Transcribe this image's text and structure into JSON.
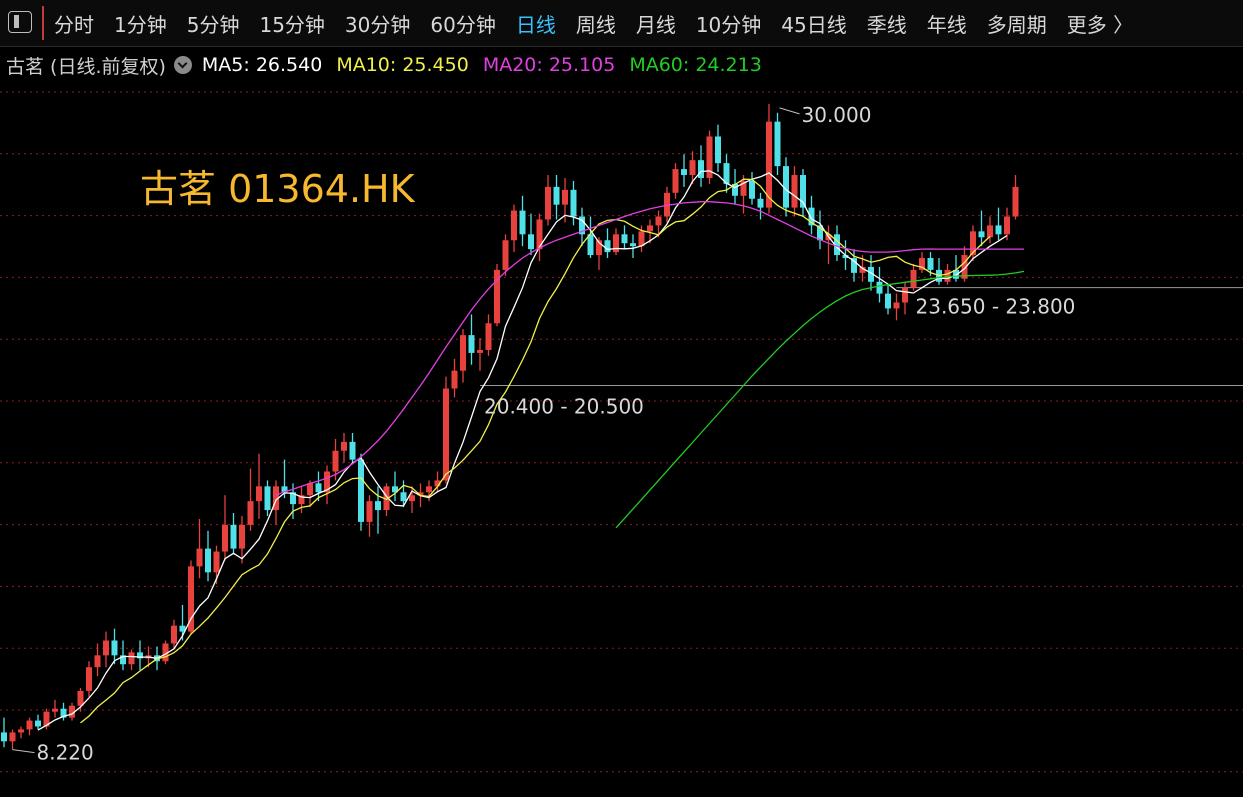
{
  "toolbar": {
    "tabs": [
      "分时",
      "1分钟",
      "5分钟",
      "15分钟",
      "30分钟",
      "60分钟",
      "日线",
      "周线",
      "月线",
      "10分钟",
      "45日线",
      "季线",
      "年线",
      "多周期",
      "更多 〉"
    ],
    "active_tab": "日线"
  },
  "legend": {
    "stock_label": "古茗 (日线.前复权)",
    "ma5": "MA5: 26.540",
    "ma10": "MA10: 25.450",
    "ma20": "MA20: 25.105",
    "ma60": "MA60: 24.213"
  },
  "colors": {
    "up": "#e8423f",
    "down": "#4fe0e8",
    "ma5": "#ffffff",
    "ma10": "#f0f04a",
    "ma20": "#e040e0",
    "ma60": "#22cc22",
    "title": "#f5b82e",
    "active_tab": "#39c0ff",
    "grid": "#8a1f1f"
  },
  "chart_data": {
    "type": "candlestick",
    "title": "古茗 01364.HK",
    "y_range": [
      7.6,
      30.4
    ],
    "annotations": {
      "high": {
        "label": "30.000",
        "value": 30.0
      },
      "low": {
        "label": "8.220",
        "value": 8.22
      },
      "gap_upper": {
        "label": "23.650 - 23.800",
        "value": 23.8
      },
      "gap_lower": {
        "label": "20.400 - 20.500",
        "value": 20.5
      }
    },
    "candles": [
      [
        8.8,
        9.3,
        8.3,
        8.5
      ],
      [
        8.5,
        8.9,
        8.22,
        8.8
      ],
      [
        8.8,
        9.0,
        8.6,
        8.9
      ],
      [
        8.9,
        9.3,
        8.7,
        9.2
      ],
      [
        9.2,
        9.4,
        8.9,
        9.0
      ],
      [
        9.0,
        9.6,
        8.9,
        9.5
      ],
      [
        9.5,
        9.9,
        9.3,
        9.6
      ],
      [
        9.6,
        9.8,
        9.2,
        9.3
      ],
      [
        9.3,
        9.8,
        9.2,
        9.7
      ],
      [
        9.7,
        10.3,
        9.5,
        10.2
      ],
      [
        10.2,
        11.2,
        10.0,
        11.0
      ],
      [
        11.0,
        11.8,
        10.7,
        11.4
      ],
      [
        11.4,
        12.2,
        11.0,
        11.9
      ],
      [
        11.9,
        12.3,
        11.1,
        11.4
      ],
      [
        11.4,
        11.9,
        10.9,
        11.1
      ],
      [
        11.1,
        11.6,
        10.9,
        11.5
      ],
      [
        11.5,
        11.9,
        10.9,
        11.3
      ],
      [
        11.3,
        11.7,
        11.0,
        11.4
      ],
      [
        11.4,
        11.7,
        10.9,
        11.2
      ],
      [
        11.2,
        11.9,
        11.1,
        11.8
      ],
      [
        11.8,
        12.6,
        11.6,
        12.4
      ],
      [
        12.4,
        13.1,
        11.9,
        12.2
      ],
      [
        12.2,
        14.6,
        12.1,
        14.4
      ],
      [
        14.4,
        16.0,
        14.0,
        15.0
      ],
      [
        15.0,
        15.6,
        13.9,
        14.2
      ],
      [
        14.2,
        15.1,
        13.8,
        14.9
      ],
      [
        14.9,
        16.8,
        14.6,
        15.8
      ],
      [
        15.8,
        16.2,
        14.8,
        15.0
      ],
      [
        15.0,
        16.1,
        14.5,
        15.8
      ],
      [
        15.8,
        17.7,
        15.6,
        16.6
      ],
      [
        16.6,
        18.2,
        16.0,
        17.1
      ],
      [
        17.1,
        17.3,
        16.1,
        16.3
      ],
      [
        16.3,
        17.3,
        15.8,
        17.1
      ],
      [
        17.1,
        18.0,
        16.7,
        16.9
      ],
      [
        16.9,
        17.2,
        16.0,
        16.5
      ],
      [
        16.5,
        17.1,
        16.2,
        16.8
      ],
      [
        16.8,
        17.3,
        16.4,
        17.2
      ],
      [
        17.2,
        17.6,
        16.6,
        16.9
      ],
      [
        16.9,
        17.8,
        16.5,
        17.6
      ],
      [
        17.6,
        18.7,
        17.3,
        18.3
      ],
      [
        18.3,
        18.9,
        17.9,
        18.6
      ],
      [
        18.6,
        18.9,
        17.9,
        18.0
      ],
      [
        18.0,
        18.2,
        15.6,
        15.9
      ],
      [
        15.9,
        16.8,
        15.4,
        16.6
      ],
      [
        16.6,
        17.1,
        15.5,
        16.3
      ],
      [
        16.3,
        17.2,
        16.1,
        17.1
      ],
      [
        17.1,
        17.6,
        16.6,
        16.9
      ],
      [
        16.9,
        17.3,
        16.4,
        16.6
      ],
      [
        16.6,
        17.1,
        16.2,
        16.8
      ],
      [
        16.8,
        17.2,
        16.4,
        16.9
      ],
      [
        16.9,
        17.3,
        16.6,
        17.1
      ],
      [
        17.1,
        17.6,
        16.9,
        17.3
      ],
      [
        17.3,
        20.8,
        17.2,
        20.4
      ],
      [
        20.4,
        21.4,
        20.1,
        21.0
      ],
      [
        21.0,
        22.4,
        20.6,
        22.2
      ],
      [
        22.2,
        22.9,
        21.2,
        21.6
      ],
      [
        21.6,
        22.1,
        21.0,
        21.7
      ],
      [
        21.7,
        22.9,
        21.5,
        22.6
      ],
      [
        22.6,
        24.6,
        22.5,
        24.4
      ],
      [
        24.4,
        25.6,
        24.2,
        25.4
      ],
      [
        25.4,
        26.6,
        25.0,
        26.4
      ],
      [
        26.4,
        26.9,
        25.2,
        25.6
      ],
      [
        25.6,
        26.3,
        24.9,
        25.1
      ],
      [
        25.1,
        26.3,
        24.7,
        26.1
      ],
      [
        26.1,
        27.6,
        25.9,
        27.2
      ],
      [
        27.2,
        27.6,
        26.1,
        26.6
      ],
      [
        26.6,
        27.5,
        26.0,
        27.1
      ],
      [
        27.1,
        27.4,
        25.9,
        26.2
      ],
      [
        26.2,
        26.5,
        25.2,
        25.6
      ],
      [
        25.6,
        26.2,
        24.8,
        24.9
      ],
      [
        24.9,
        25.5,
        24.4,
        25.4
      ],
      [
        25.4,
        25.8,
        24.8,
        25.0
      ],
      [
        25.0,
        25.8,
        24.9,
        25.6
      ],
      [
        25.6,
        25.9,
        25.1,
        25.3
      ],
      [
        25.3,
        25.6,
        24.8,
        25.2
      ],
      [
        25.2,
        25.9,
        25.0,
        25.7
      ],
      [
        25.7,
        26.1,
        25.3,
        25.9
      ],
      [
        25.9,
        26.4,
        25.5,
        26.2
      ],
      [
        26.2,
        27.2,
        26.0,
        27.0
      ],
      [
        27.0,
        28.0,
        26.8,
        27.8
      ],
      [
        27.8,
        28.3,
        27.2,
        27.6
      ],
      [
        27.6,
        28.4,
        27.3,
        28.1
      ],
      [
        28.1,
        28.6,
        27.2,
        27.5
      ],
      [
        27.5,
        29.1,
        27.3,
        28.9
      ],
      [
        28.9,
        29.3,
        27.7,
        28.0
      ],
      [
        28.0,
        28.3,
        27.0,
        27.3
      ],
      [
        27.3,
        27.8,
        26.6,
        26.9
      ],
      [
        26.9,
        27.6,
        26.3,
        27.4
      ],
      [
        27.4,
        27.7,
        26.6,
        26.8
      ],
      [
        26.8,
        27.0,
        26.1,
        26.5
      ],
      [
        26.5,
        30.0,
        26.3,
        29.4
      ],
      [
        29.4,
        29.7,
        27.6,
        27.9
      ],
      [
        27.9,
        28.2,
        26.2,
        26.5
      ],
      [
        26.5,
        27.9,
        26.2,
        27.6
      ],
      [
        27.6,
        27.8,
        26.2,
        26.5
      ],
      [
        26.5,
        26.9,
        25.6,
        25.9
      ],
      [
        25.9,
        26.4,
        25.1,
        25.4
      ],
      [
        25.4,
        25.9,
        24.6,
        25.6
      ],
      [
        25.6,
        25.9,
        24.7,
        24.9
      ],
      [
        24.9,
        25.4,
        24.4,
        24.8
      ],
      [
        24.8,
        25.1,
        24.0,
        24.3
      ],
      [
        24.3,
        24.9,
        24.0,
        24.5
      ],
      [
        24.5,
        24.9,
        23.7,
        24.0
      ],
      [
        24.0,
        24.5,
        23.3,
        23.6
      ],
      [
        23.6,
        23.9,
        22.9,
        23.1
      ],
      [
        23.1,
        23.6,
        22.7,
        23.3
      ],
      [
        23.3,
        24.0,
        22.9,
        23.8
      ],
      [
        23.8,
        24.6,
        23.7,
        24.4
      ],
      [
        24.4,
        25.0,
        24.3,
        24.8
      ],
      [
        24.8,
        25.0,
        24.2,
        24.4
      ],
      [
        24.4,
        24.8,
        23.9,
        24.0
      ],
      [
        24.0,
        24.6,
        23.9,
        24.4
      ],
      [
        24.4,
        24.9,
        24.0,
        24.1
      ],
      [
        24.1,
        25.2,
        24.0,
        24.9
      ],
      [
        24.9,
        25.9,
        24.7,
        25.7
      ],
      [
        25.7,
        26.4,
        25.2,
        25.5
      ],
      [
        25.5,
        26.2,
        25.3,
        25.9
      ],
      [
        25.9,
        26.5,
        25.4,
        25.6
      ],
      [
        25.6,
        26.5,
        25.4,
        26.2
      ],
      [
        26.2,
        27.6,
        26.1,
        27.2
      ]
    ],
    "series": [
      {
        "name": "MA5",
        "start": 4,
        "values": [
          8.88,
          9.04,
          9.22,
          9.34,
          9.42,
          9.66,
          9.96,
          10.3,
          10.8,
          11.22,
          11.36,
          11.36,
          11.34,
          11.34,
          11.3,
          11.44,
          11.62,
          12.06,
          12.64,
          13.06,
          13.34,
          13.98,
          14.66,
          14.84,
          14.66,
          14.98,
          15.32,
          15.94,
          16.64,
          16.88,
          16.86,
          16.74,
          16.72,
          16.86,
          16.98,
          17.16,
          17.58,
          17.89,
          18.06,
          17.58,
          17.16,
          16.76,
          16.46,
          16.44,
          16.94,
          16.78,
          16.72,
          16.92,
          17.06,
          17.88,
          18.59,
          19.44,
          20.3,
          20.76,
          21.4,
          22.5,
          23.14,
          23.8,
          24.64,
          25.18,
          25.6,
          26.02,
          26.24,
          26.18,
          26.08,
          25.74,
          25.32,
          25.09,
          25.12,
          25.11,
          25.13,
          25.21,
          25.38,
          25.58,
          25.94,
          26.49,
          26.86,
          27.38,
          27.72,
          27.74,
          27.6,
          27.32,
          27.18,
          27.32,
          27.46,
          27.54,
          27.67,
          27.42,
          27.1,
          26.9,
          26.68,
          26.12,
          25.96,
          25.52,
          25.16,
          24.89,
          24.7,
          24.45,
          24.3,
          24.11,
          23.92,
          23.7,
          23.66,
          23.62,
          23.8,
          23.98,
          24.12,
          24.11,
          24.22,
          24.44,
          24.78,
          24.99,
          25.2,
          25.37,
          25.56
        ]
      },
      {
        "name": "MA10",
        "start": 9,
        "values": [
          9.12,
          9.35,
          9.66,
          9.89,
          10.13,
          10.48,
          10.65,
          10.87,
          11.08,
          11.28,
          11.35,
          11.49,
          11.72,
          12.12,
          12.38,
          12.66,
          13.0,
          13.35,
          13.74,
          14.12,
          14.3,
          14.45,
          14.82,
          15.34,
          15.9,
          16.26,
          16.39,
          16.44,
          16.72,
          16.85,
          16.99,
          17.22,
          17.36,
          17.38,
          17.02,
          16.78,
          16.66,
          16.86,
          17.13,
          17.05,
          16.79,
          16.76,
          17.09,
          17.51,
          17.72,
          17.98,
          18.3,
          18.62,
          19.18,
          19.87,
          20.28,
          20.8,
          21.36,
          21.97,
          22.76,
          23.33,
          23.77,
          24.27,
          24.81,
          25.26,
          25.62,
          25.95,
          26.07,
          26.1,
          26.04,
          25.87,
          25.73,
          25.66,
          25.58,
          25.84,
          26.02,
          26.06,
          26.28,
          26.52,
          26.84,
          27.04,
          27.09,
          27.28,
          27.46,
          27.45,
          27.22,
          26.84,
          26.58,
          26.41,
          26.31,
          26.21,
          26.0,
          25.82,
          25.62,
          25.38,
          25.13,
          24.86,
          24.77,
          24.66,
          24.72,
          24.82,
          24.86,
          24.66,
          24.56,
          24.49,
          24.31,
          24.21,
          24.26,
          24.4,
          24.65,
          24.99,
          25.26,
          25.53
        ]
      },
      {
        "name": "MA20",
        "start": 32,
        "values": [
          16.8,
          16.92,
          17.0,
          17.1,
          17.2,
          17.28,
          17.38,
          17.5,
          17.66,
          17.86,
          18.1,
          18.36,
          18.64,
          18.96,
          19.32,
          19.7,
          20.1,
          20.5,
          20.92,
          21.36,
          21.8,
          22.22,
          22.64,
          23.05,
          23.42,
          23.76,
          24.06,
          24.34,
          24.58,
          24.8,
          24.98,
          25.14,
          25.28,
          25.4,
          25.5,
          25.6,
          25.7,
          25.8,
          25.9,
          26.0,
          26.1,
          26.2,
          26.3,
          26.38,
          26.46,
          26.52,
          26.58,
          26.62,
          26.66,
          26.68,
          26.7,
          26.7,
          26.68,
          26.66,
          26.62,
          26.56,
          26.48,
          26.38,
          26.24,
          26.1,
          25.96,
          25.82,
          25.68,
          25.54,
          25.42,
          25.3,
          25.2,
          25.12,
          25.06,
          25.02,
          25.0,
          25.0,
          25.0,
          25.02,
          25.05,
          25.08,
          25.1,
          25.105,
          25.1,
          25.1,
          25.1,
          25.1,
          25.1,
          25.1,
          25.1,
          25.1,
          25.1,
          25.1,
          25.1
        ]
      },
      {
        "name": "MA60",
        "start": 72,
        "values": [
          15.7,
          16.02,
          16.34,
          16.66,
          16.98,
          17.3,
          17.62,
          17.94,
          18.26,
          18.58,
          18.9,
          19.22,
          19.54,
          19.86,
          20.18,
          20.5,
          20.82,
          21.12,
          21.42,
          21.72,
          22.0,
          22.26,
          22.52,
          22.76,
          22.98,
          23.18,
          23.36,
          23.52,
          23.64,
          23.74,
          23.8,
          23.86,
          23.9,
          23.94,
          23.98,
          24.02,
          24.06,
          24.1,
          24.14,
          24.17,
          24.19,
          24.2,
          24.21,
          24.213,
          24.22,
          24.23,
          24.26,
          24.3,
          24.35
        ]
      }
    ]
  }
}
